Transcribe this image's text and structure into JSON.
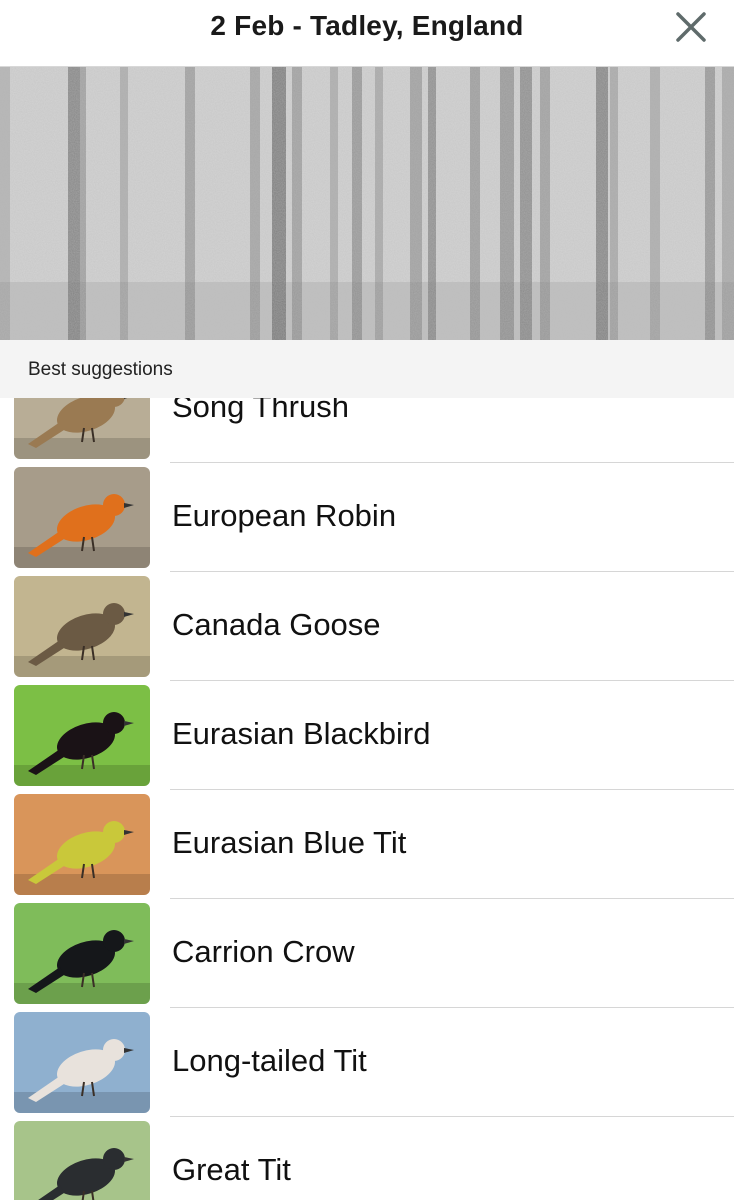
{
  "header": {
    "title": "2 Feb - Tadley, England",
    "close_icon": "close-icon"
  },
  "spectrogram": {
    "icon": "spectrogram-image"
  },
  "section": {
    "title": "Best suggestions"
  },
  "suggestions": [
    {
      "name": "Song Thrush",
      "thumb_bg": "#b8ad96",
      "bird_color": "#9a7a52"
    },
    {
      "name": "European Robin",
      "thumb_bg": "#a79c8a",
      "bird_color": "#e0701c"
    },
    {
      "name": "Canada Goose",
      "thumb_bg": "#c2b590",
      "bird_color": "#6b5a44"
    },
    {
      "name": "Eurasian Blackbird",
      "thumb_bg": "#7cbf45",
      "bird_color": "#1a1216"
    },
    {
      "name": "Eurasian Blue Tit",
      "thumb_bg": "#d9955a",
      "bird_color": "#c9c83a"
    },
    {
      "name": "Carrion Crow",
      "thumb_bg": "#7fbc5a",
      "bird_color": "#15171a"
    },
    {
      "name": "Long-tailed Tit",
      "thumb_bg": "#8fb0cf",
      "bird_color": "#e8e2dc"
    },
    {
      "name": "Great Tit",
      "thumb_bg": "#a7c48a",
      "bird_color": "#2a2d30"
    }
  ]
}
